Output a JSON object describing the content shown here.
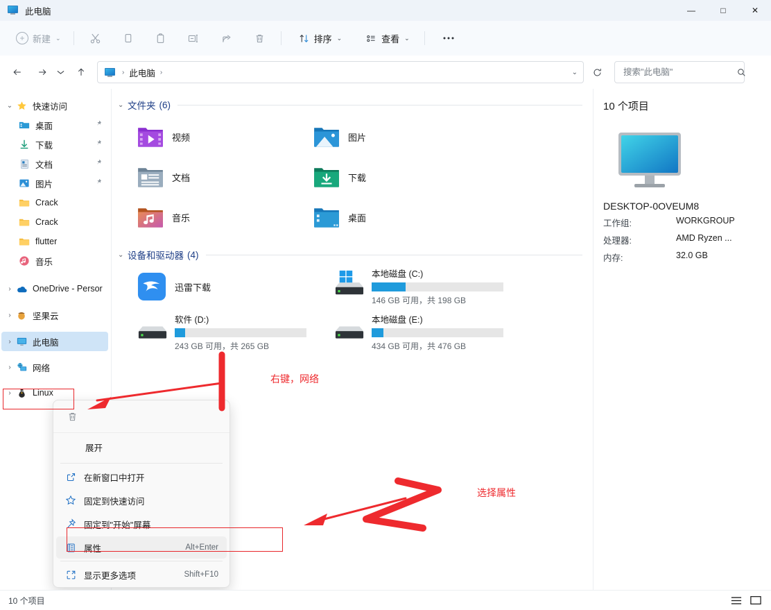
{
  "window": {
    "title": "此电脑",
    "title_icon": "this-pc-icon",
    "controls": {
      "minimize": "—",
      "maximize": "□",
      "close": "✕"
    }
  },
  "toolbar": {
    "new_label": "新建",
    "new_icon": "plus-circle-icon",
    "cut_icon": "scissors-icon",
    "copy_icon": "copy-icon",
    "paste_icon": "paste-icon",
    "rename_icon": "rename-icon",
    "share_icon": "share-icon",
    "delete_icon": "trash-icon",
    "sort_label": "排序",
    "sort_icon": "sort-arrows-icon",
    "view_label": "查看",
    "view_icon": "view-list-icon",
    "more_label": "…",
    "more_icon": "ellipsis-icon"
  },
  "addressbar": {
    "back_icon": "arrow-left-icon",
    "forward_icon": "arrow-right-icon",
    "recent_icon": "chevron-down-icon",
    "up_icon": "arrow-up-icon",
    "crumb_icon": "this-pc-icon",
    "crumbs": [
      "此电脑"
    ],
    "dropdown_icon": "chevron-down-icon",
    "refresh_icon": "refresh-icon"
  },
  "search": {
    "placeholder": "搜索\"此电脑\"",
    "value": "",
    "icon": "search-icon"
  },
  "sidebar": {
    "items": [
      {
        "label": "快速访问",
        "icon": "star-icon",
        "expander": "expanded",
        "indent": 0,
        "pinned": false,
        "selected": false
      },
      {
        "label": "桌面",
        "icon": "desktop-folder-icon",
        "expander": "none",
        "indent": 1,
        "pinned": true,
        "selected": false
      },
      {
        "label": "下载",
        "icon": "downloads-folder-icon",
        "expander": "none",
        "indent": 1,
        "pinned": true,
        "selected": false
      },
      {
        "label": "文档",
        "icon": "documents-folder-icon",
        "expander": "none",
        "indent": 1,
        "pinned": true,
        "selected": false
      },
      {
        "label": "图片",
        "icon": "pictures-folder-icon",
        "expander": "none",
        "indent": 1,
        "pinned": true,
        "selected": false
      },
      {
        "label": "Crack",
        "icon": "folder-icon",
        "expander": "none",
        "indent": 1,
        "pinned": false,
        "selected": false
      },
      {
        "label": "Crack",
        "icon": "folder-icon",
        "expander": "none",
        "indent": 1,
        "pinned": false,
        "selected": false
      },
      {
        "label": "flutter",
        "icon": "folder-icon",
        "expander": "none",
        "indent": 1,
        "pinned": false,
        "selected": false
      },
      {
        "label": "音乐",
        "icon": "music-folder-icon",
        "expander": "none",
        "indent": 1,
        "pinned": false,
        "selected": false
      },
      {
        "label": "OneDrive - Persor",
        "icon": "onedrive-icon",
        "expander": "collapsed",
        "indent": 0,
        "pinned": false,
        "selected": false
      },
      {
        "label": "坚果云",
        "icon": "nutstore-icon",
        "expander": "collapsed",
        "indent": 0,
        "pinned": false,
        "selected": false
      },
      {
        "label": "此电脑",
        "icon": "this-pc-icon",
        "expander": "collapsed",
        "indent": 0,
        "pinned": false,
        "selected": true
      },
      {
        "label": "网络",
        "icon": "network-icon",
        "expander": "collapsed",
        "indent": 0,
        "pinned": false,
        "selected": false
      },
      {
        "label": "Linux",
        "icon": "linux-icon",
        "expander": "collapsed",
        "indent": 0,
        "pinned": false,
        "selected": false
      }
    ]
  },
  "main": {
    "groups": [
      {
        "title": "文件夹",
        "count": "(6)",
        "expander": "expanded",
        "type": "folders",
        "items": [
          {
            "label": "视频",
            "icon": "videos-folder-icon"
          },
          {
            "label": "图片",
            "icon": "pictures-folder-icon"
          },
          {
            "label": "文档",
            "icon": "documents-folder-icon"
          },
          {
            "label": "下载",
            "icon": "downloads-folder-icon"
          },
          {
            "label": "音乐",
            "icon": "music-folder-icon"
          },
          {
            "label": "桌面",
            "icon": "desktop-folder-icon"
          }
        ]
      },
      {
        "title": "设备和驱动器",
        "count": "(4)",
        "expander": "expanded",
        "type": "drives",
        "items": [
          {
            "label": "迅雷下载",
            "icon": "thunder-app-icon",
            "has_bar": false,
            "free": "",
            "fill_pct": 0
          },
          {
            "label": "本地磁盘 (C:)",
            "icon": "windows-drive-icon",
            "has_bar": true,
            "free": "146 GB 可用，共 198 GB",
            "fill_pct": 26
          },
          {
            "label": "软件 (D:)",
            "icon": "drive-icon",
            "has_bar": true,
            "free": "243 GB 可用，共 265 GB",
            "fill_pct": 8
          },
          {
            "label": "本地磁盘 (E:)",
            "icon": "drive-icon",
            "has_bar": true,
            "free": "434 GB 可用，共 476 GB",
            "fill_pct": 9
          }
        ]
      }
    ]
  },
  "details": {
    "count_text": "10 个项目",
    "pc_icon": "monitor-icon",
    "pc_name": "DESKTOP-0OVEUM8",
    "properties": [
      {
        "key": "工作组:",
        "value": "WORKGROUP"
      },
      {
        "key": "处理器:",
        "value": "AMD Ryzen ..."
      },
      {
        "key": "内存:",
        "value": "32.0 GB"
      }
    ]
  },
  "context_menu": {
    "top_actions": [
      {
        "icon": "trash-icon",
        "name": "delete"
      }
    ],
    "expand_label": "展开",
    "items": [
      {
        "label": "在新窗口中打开",
        "icon": "open-new-window-icon",
        "shortcut": "",
        "highlighted": false
      },
      {
        "label": "固定到快速访问",
        "icon": "star-outline-icon",
        "shortcut": "",
        "highlighted": false
      },
      {
        "label": "固定到\"开始\"屏幕",
        "icon": "pin-icon",
        "shortcut": "",
        "highlighted": false
      },
      {
        "label": "属性",
        "icon": "properties-icon",
        "shortcut": "Alt+Enter",
        "highlighted": true
      },
      {
        "label": "显示更多选项",
        "icon": "more-options-icon",
        "shortcut": "Shift+F10",
        "highlighted": false
      }
    ]
  },
  "statusbar": {
    "text": "10 个项目",
    "view_details_icon": "list-view-icon",
    "view_large_icon": "tiles-view-icon"
  },
  "annotations": {
    "accent_color": "#ee2a2e",
    "note_network": "右键，网络",
    "note_properties": "选择属性",
    "marker_one": "1",
    "marker_two": "2"
  }
}
